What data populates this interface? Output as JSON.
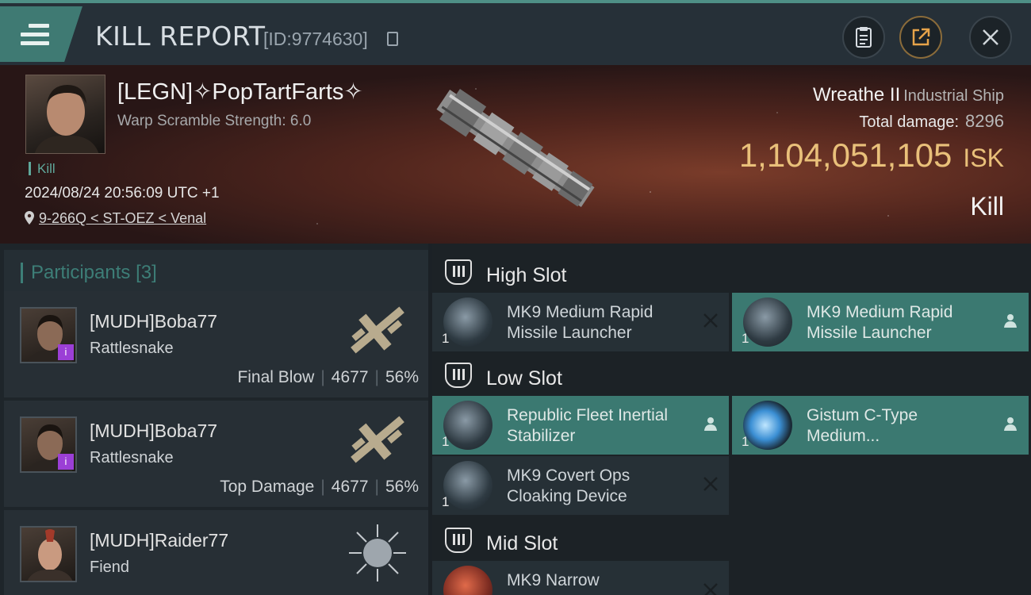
{
  "header": {
    "title": "KILL REPORT",
    "report_id": "[ID:9774630]",
    "buttons": [
      "clipboard",
      "share",
      "close"
    ]
  },
  "victim": {
    "name": "[LEGN]✧PopTartFarts✧",
    "warp_scramble": "Warp Scramble Strength: 6.0",
    "tag": "Kill",
    "timestamp": "2024/08/24 20:56:09 UTC +1",
    "location": "9-266Q < ST-OEZ < Venal",
    "ship_name": "Wreathe II",
    "ship_class": "Industrial Ship",
    "total_damage_label": "Total damage:",
    "total_damage": "8296",
    "isk_value": "1,104,051,105",
    "isk_unit": "ISK",
    "result": "Kill"
  },
  "participants": {
    "label": "Participants",
    "count": "[3]",
    "rows": [
      {
        "name": "[MUDH]Boba77",
        "ship": "Rattlesnake",
        "tag": "Final Blow",
        "damage": "4677",
        "percent": "56%",
        "badge": "i"
      },
      {
        "name": "[MUDH]Boba77",
        "ship": "Rattlesnake",
        "tag": "Top Damage",
        "damage": "4677",
        "percent": "56%",
        "badge": "i"
      },
      {
        "name": "[MUDH]Raider77",
        "ship": "Fiend",
        "tag": "",
        "damage": "",
        "percent": ""
      }
    ]
  },
  "slots": {
    "high": {
      "label": "High Slot",
      "items": [
        {
          "name": "MK9 Medium Rapid Missile Launcher",
          "qty": "1",
          "status": "destroyed"
        },
        {
          "name": "MK9 Medium Rapid Missile Launcher",
          "qty": "1",
          "status": "dropped"
        }
      ]
    },
    "low": {
      "label": "Low Slot",
      "items": [
        {
          "name": "Republic Fleet Inertial Stabilizer",
          "qty": "1",
          "status": "dropped"
        },
        {
          "name": "Gistum C-Type Medium...",
          "qty": "1",
          "status": "dropped"
        },
        {
          "name": "MK9 Covert Ops Cloaking Device",
          "qty": "1",
          "status": "destroyed"
        }
      ]
    },
    "mid": {
      "label": "Mid Slot",
      "items": [
        {
          "name": "MK9 Narrow",
          "qty": "",
          "status": "destroyed"
        }
      ]
    }
  },
  "colors": {
    "accent_teal": "#3b7971",
    "isk_gold": "#e9c07a",
    "badge_purple": "#9b3fd6"
  }
}
